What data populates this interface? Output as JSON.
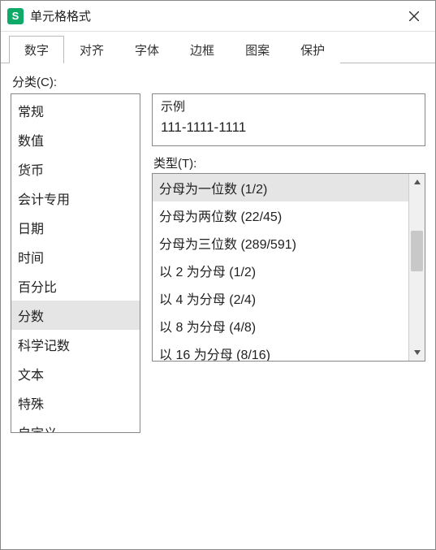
{
  "title": "单元格格式",
  "app_icon_letter": "S",
  "tabs": [
    {
      "label": "数字",
      "active": true
    },
    {
      "label": "对齐",
      "active": false
    },
    {
      "label": "字体",
      "active": false
    },
    {
      "label": "边框",
      "active": false
    },
    {
      "label": "图案",
      "active": false
    },
    {
      "label": "保护",
      "active": false
    }
  ],
  "category_label": "分类(C):",
  "categories": [
    {
      "label": "常规",
      "selected": false
    },
    {
      "label": "数值",
      "selected": false
    },
    {
      "label": "货币",
      "selected": false
    },
    {
      "label": "会计专用",
      "selected": false
    },
    {
      "label": "日期",
      "selected": false
    },
    {
      "label": "时间",
      "selected": false
    },
    {
      "label": "百分比",
      "selected": false
    },
    {
      "label": "分数",
      "selected": true
    },
    {
      "label": "科学记数",
      "selected": false
    },
    {
      "label": "文本",
      "selected": false
    },
    {
      "label": "特殊",
      "selected": false
    },
    {
      "label": "自定义",
      "selected": false
    }
  ],
  "example_label": "示例",
  "example_value": "111-1111-1111",
  "type_label": "类型(T):",
  "types": [
    {
      "label": "分母为一位数 (1/2)",
      "selected": true
    },
    {
      "label": "分母为两位数 (22/45)",
      "selected": false
    },
    {
      "label": "分母为三位数 (289/591)",
      "selected": false
    },
    {
      "label": "以 2 为分母 (1/2)",
      "selected": false
    },
    {
      "label": "以 4 为分母 (2/4)",
      "selected": false
    },
    {
      "label": "以 8 为分母 (4/8)",
      "selected": false
    },
    {
      "label": "以 16 为分母 (8/16)",
      "selected": false
    }
  ]
}
